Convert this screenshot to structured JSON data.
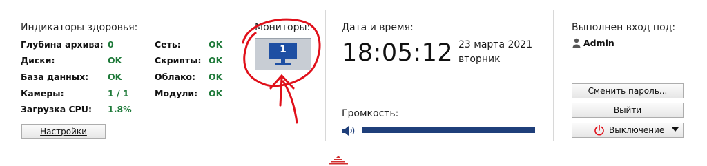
{
  "health": {
    "title": "Индикаторы здоровья:",
    "left": [
      {
        "label": "Глубина архива:",
        "value": "0"
      },
      {
        "label": "Диски:",
        "value": "OK"
      },
      {
        "label": "База данных:",
        "value": "OK"
      },
      {
        "label": "Камеры:",
        "value": "1 / 1"
      },
      {
        "label": "Загрузка CPU:",
        "value": "1.8%"
      }
    ],
    "right": [
      {
        "label": "Сеть:",
        "value": "OK"
      },
      {
        "label": "Скрипты:",
        "value": "OK"
      },
      {
        "label": "Облако:",
        "value": "OK"
      },
      {
        "label": "Модули:",
        "value": "OK"
      }
    ],
    "settings_button": "Настройки"
  },
  "monitors": {
    "title": "Мониторы:",
    "monitor_number": "1"
  },
  "datetime": {
    "title": "Дата и время:",
    "time": "18:05:12",
    "date": "23 марта 2021",
    "weekday": "вторник"
  },
  "volume": {
    "title": "Громкость:",
    "level": 1.0
  },
  "login": {
    "title": "Выполнен вход под:",
    "user": "Admin",
    "change_password_button": "Сменить пароль...",
    "logout_button": "Выйти",
    "shutdown_button": "Выключение"
  },
  "colors": {
    "ok_green": "#1f7a3a",
    "monitor_blue": "#1e4fa3",
    "volume_bar": "#1f3f7a",
    "annotation_red": "#e0101a"
  }
}
